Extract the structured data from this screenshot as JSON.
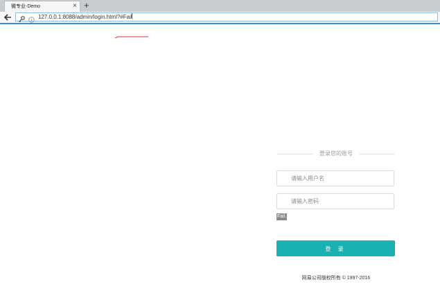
{
  "browser": {
    "tab_title": "微专业-Demo",
    "tab_close": "×",
    "new_tab": "+",
    "url": "127.0.0.1:8088/admin/login.html?#Fail.",
    "text_cursor": "I"
  },
  "login": {
    "heading": "登录您的账号",
    "username_placeholder": "请输入用户名",
    "password_placeholder": "请输入密码",
    "error_text": "Fail.",
    "submit_label": "登 录"
  },
  "footer": {
    "copyright": "网易公司版权所有 © 1997-2016"
  },
  "colors": {
    "accent": "#1ab1b3",
    "browser_focus": "#3d8ccf",
    "annotation_red": "#e03030"
  }
}
